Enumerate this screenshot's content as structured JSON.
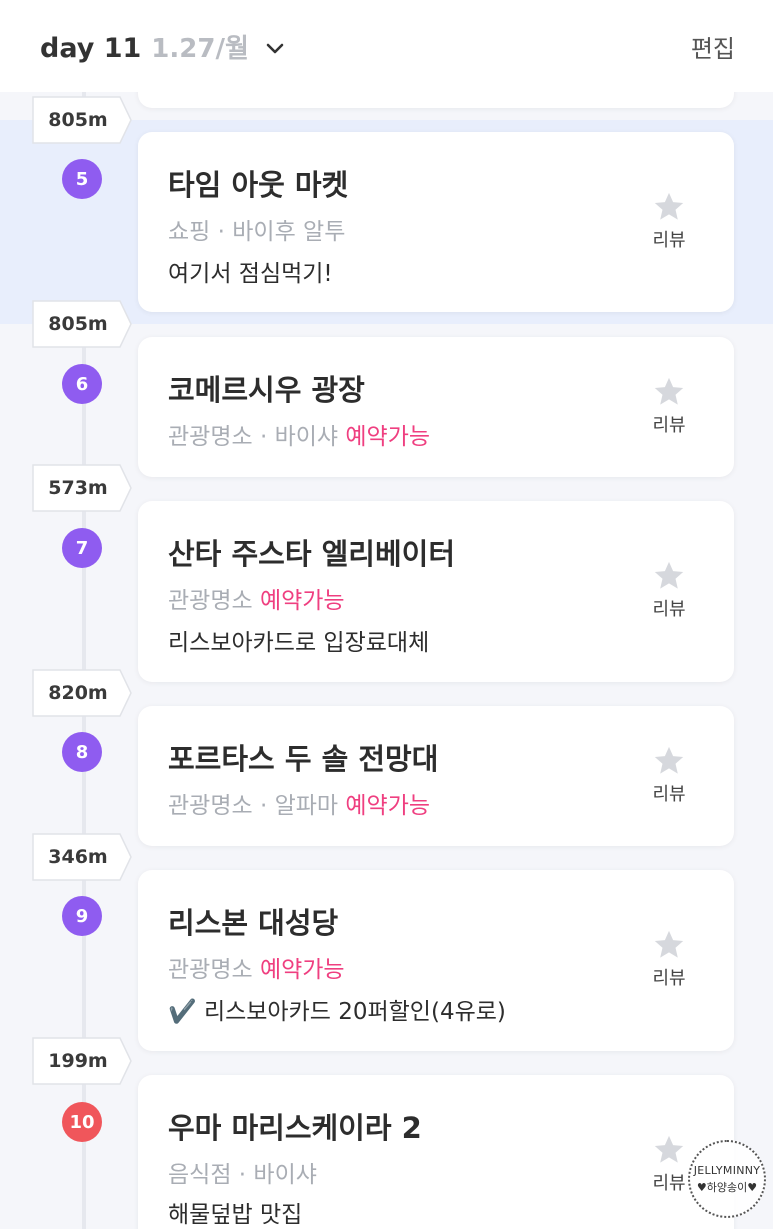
{
  "header": {
    "day_label": "day 11",
    "date_label": "1.27/월",
    "edit_label": "편집"
  },
  "distances": [
    "805m",
    "805m",
    "573m",
    "820m",
    "346m",
    "199m"
  ],
  "places": [
    {
      "number": "5",
      "title": "타임 아웃 마켓",
      "category": "쇼핑 · 바이후 알투",
      "availability": "",
      "note": "여기서 점심먹기!",
      "review_label": "리뷰",
      "highlighted": true
    },
    {
      "number": "6",
      "title": "코메르시우 광장",
      "category": "관광명소 · 바이샤 ",
      "availability": "예약가능",
      "note": "",
      "review_label": "리뷰"
    },
    {
      "number": "7",
      "title": "산타 주스타 엘리베이터",
      "category": "관광명소 ",
      "availability": "예약가능",
      "note": "리스보아카드로 입장료대체",
      "review_label": "리뷰"
    },
    {
      "number": "8",
      "title": "포르타스 두 솔 전망대",
      "category": "관광명소 · 알파마 ",
      "availability": "예약가능",
      "note": "",
      "review_label": "리뷰"
    },
    {
      "number": "9",
      "title": "리스본 대성당",
      "category": "관광명소 ",
      "availability": "예약가능",
      "note": "✔️ 리스보아카드 20퍼할인(4유로)",
      "review_label": "리뷰"
    },
    {
      "number": "10",
      "title": "우마 마리스케이라 2",
      "category": "음식점 · 바이샤",
      "availability": "",
      "note": "해물덮밥 맛집",
      "review_label": "리뷰"
    }
  ],
  "watermark": {
    "line1": "JELLYMINNY",
    "line2": "♥하양송이♥"
  },
  "colors": {
    "accent_purple": "#8f5cf0",
    "accent_red": "#f0565b",
    "availability_pink": "#ef3f80",
    "highlight_bg": "#e8eefc"
  }
}
